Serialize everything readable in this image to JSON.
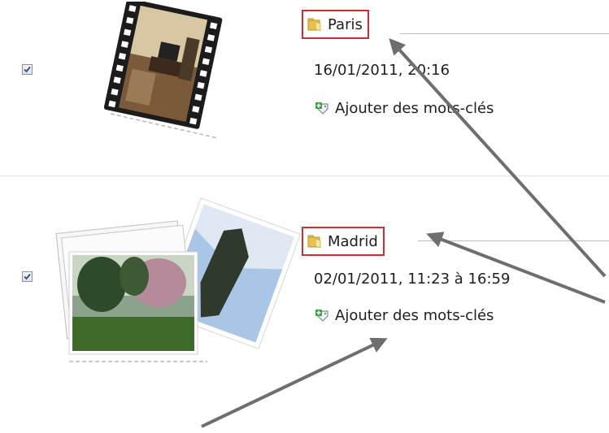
{
  "items": [
    {
      "folder_name": "Paris",
      "date": "16/01/2011, 20:16",
      "tags_label": "Ajouter des mots-clés",
      "checked": true
    },
    {
      "folder_name": "Madrid",
      "date": "02/01/2011, 11:23 à 16:59",
      "tags_label": "Ajouter des mots-clés",
      "checked": true
    }
  ],
  "colors": {
    "highlight": "#d42a33",
    "arrow": "#6e6e6e",
    "rule": "#bdbdbd"
  },
  "icons": {
    "folder": "folder-icon",
    "tags": "add-tag-icon",
    "checkbox": "checkbox-checked"
  }
}
